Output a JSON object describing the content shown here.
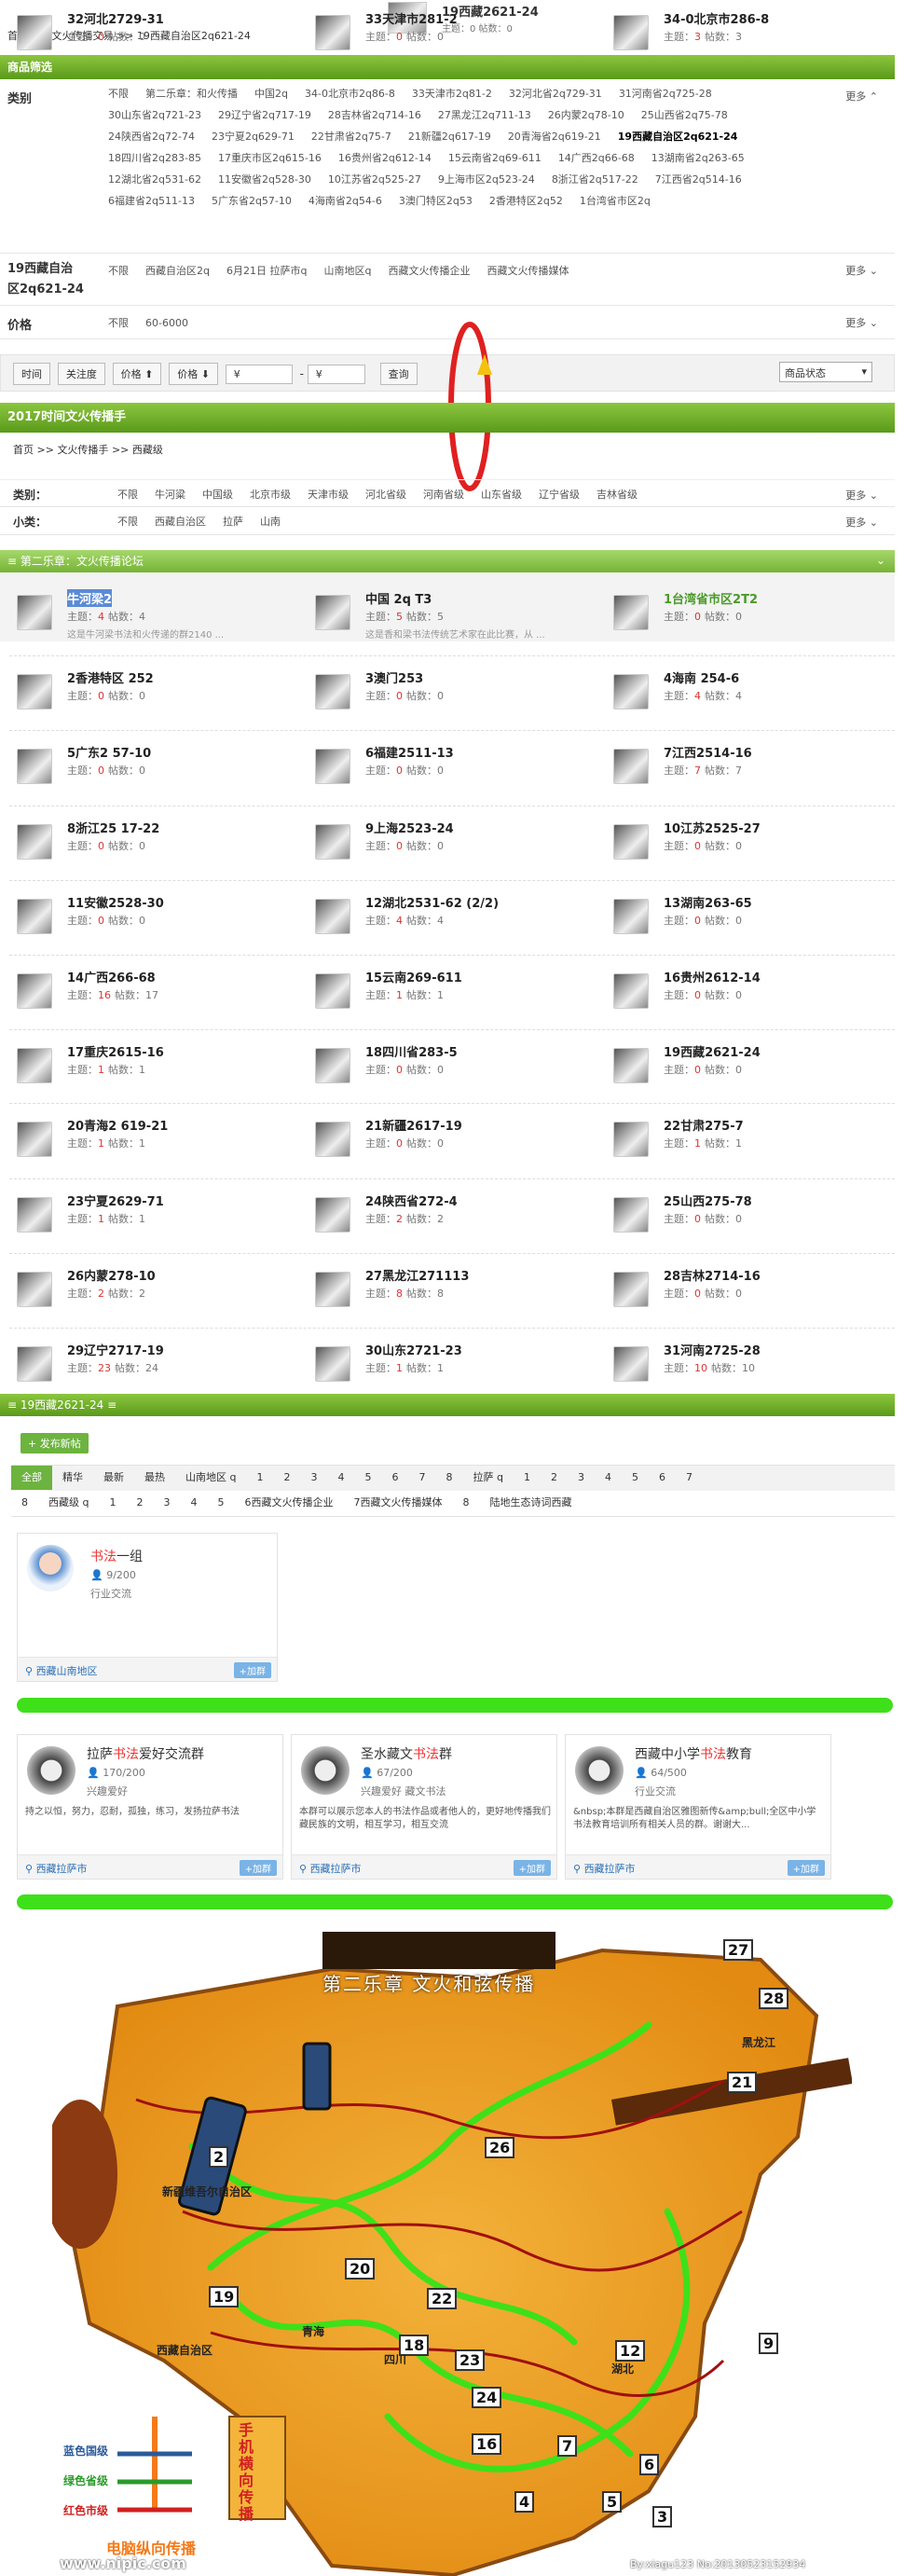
{
  "header": {
    "breadcrumb": [
      "首页",
      "文火传播交易",
      "19西藏自治区2q621-24"
    ],
    "sep": ">>",
    "thumb_title": "19西藏2621-24",
    "thumb_stats": "主题：0  帖数：0"
  },
  "filter": {
    "section_title": "商品筛选",
    "category_label": "类别",
    "category_options": [
      "不限",
      "第二乐章：和火传播",
      "中国2q",
      "34-0北京市2q86-8",
      "33天津市2q81-2",
      "32河北省2q729-31",
      "31河南省2q725-28",
      "30山东省2q721-23",
      "29辽宁省2q717-19",
      "28吉林省2q714-16",
      "27黑龙江2q711-13",
      "26内蒙2q78-10",
      "25山西省2q75-78",
      "24陕西省2q72-74",
      "23宁夏2q629-71",
      "22甘肃省2q75-7",
      "21新疆2q617-19",
      "20青海省2q619-21",
      "19西藏自治区2q621-24",
      "18四川省2q283-85",
      "17重庆市区2q615-16",
      "16贵州省2q612-14",
      "15云南省2q69-611",
      "14广西2q66-68",
      "13湖南省2q263-65",
      "12湖北省2q531-62",
      "11安徽省2q528-30",
      "10江苏省2q525-27",
      "9上海市区2q523-24",
      "8浙江省2q517-22",
      "7江西省2q514-16",
      "6福建省2q511-13",
      "5广东省2q57-10",
      "4海南省2q54-6",
      "3澳门特区2q53",
      "2香港特区2q52",
      "1台湾省市区2q"
    ],
    "category_selected": "19西藏自治区2q621-24",
    "region_label_1": "19西藏自治",
    "region_label_2": "区2q621-24",
    "region_options": [
      "不限",
      "西藏自治区2q",
      "6月21日 拉萨市q",
      "山南地区q",
      "西藏文火传播企业",
      "西藏文火传播媒体"
    ],
    "price_label": "价格",
    "price_options": [
      "不限",
      "60-6000"
    ],
    "more": "更多"
  },
  "toolbar": {
    "sort_time": "时间",
    "sort_attention": "关注度",
    "sort_price1": "价格 ⬆",
    "sort_price2": "价格 ⬇",
    "price_from": "¥",
    "dash": "-",
    "price_to": "¥",
    "query": "查询",
    "status": "商品状态"
  },
  "section2": {
    "title": "2017时间文火传播手",
    "breadcrumb": [
      "首页",
      "文火传播手",
      "西藏级"
    ],
    "sep": ">>",
    "cat_label": "类别：",
    "cat_options": [
      "不限",
      "牛河粱",
      "中国级",
      "北京市级",
      "天津市级",
      "河北省级",
      "河南省级",
      "山东省级",
      "辽宁省级",
      "吉林省级"
    ],
    "sub_label": "小类：",
    "sub_options": [
      "不限",
      "西藏自治区",
      "拉萨",
      "山南"
    ],
    "more": "更多"
  },
  "forum": {
    "title": "第二乐章：文火传播论坛",
    "items": [
      {
        "name": "牛河梁2",
        "stats_pre": "主题：",
        "topics": "4",
        "stats_mid": "帖数：4",
        "desc": "这是牛河梁书法和火传递的群2140 ..."
      },
      {
        "name": "中国 2q T3",
        "stats_pre": "主题：",
        "topics": "5",
        "stats_mid": "帖数：5",
        "desc": "这是香和梁书法传统艺术家在此比赛，从 ..."
      },
      {
        "name": "1台湾省市区2T2",
        "stats_pre": "主题：",
        "topics": "0",
        "stats_mid": "帖数：0",
        "desc": ""
      },
      {
        "name": "2香港特区 252",
        "stats_pre": "主题：",
        "topics": "0",
        "stats_mid": "帖数：0",
        "desc": ""
      },
      {
        "name": "3澳门253",
        "stats_pre": "主题：",
        "topics": "0",
        "stats_mid": "帖数：0",
        "desc": ""
      },
      {
        "name": "4海南 254-6",
        "stats_pre": "主题：",
        "topics": "4",
        "stats_mid": "帖数：4",
        "desc": ""
      },
      {
        "name": "5广东2 57-10",
        "stats_pre": "主题：",
        "topics": "0",
        "stats_mid": "帖数：0",
        "desc": ""
      },
      {
        "name": "6福建2511-13",
        "stats_pre": "主题：",
        "topics": "0",
        "stats_mid": "帖数：0",
        "desc": ""
      },
      {
        "name": "7江西2514-16",
        "stats_pre": "主题：",
        "topics": "7",
        "stats_mid": "帖数：7",
        "desc": ""
      },
      {
        "name": "8浙江25 17-22",
        "stats_pre": "主题：",
        "topics": "0",
        "stats_mid": "帖数：0",
        "desc": ""
      },
      {
        "name": "9上海2523-24",
        "stats_pre": "主题：",
        "topics": "0",
        "stats_mid": "帖数：0",
        "desc": ""
      },
      {
        "name": "10江苏2525-27",
        "stats_pre": "主题：",
        "topics": "0",
        "stats_mid": "帖数：0",
        "desc": ""
      },
      {
        "name": "11安徽2528-30",
        "stats_pre": "主题：",
        "topics": "0",
        "stats_mid": "帖数：0",
        "desc": ""
      },
      {
        "name": "12湖北2531-62 (2/2)",
        "stats_pre": "主题：",
        "topics": "4",
        "stats_mid": "帖数：4",
        "desc": ""
      },
      {
        "name": "13湖南263-65",
        "stats_pre": "主题：",
        "topics": "0",
        "stats_mid": "帖数：0",
        "desc": ""
      },
      {
        "name": "14广西266-68",
        "stats_pre": "主题：",
        "topics": "16",
        "stats_mid": "帖数：17",
        "desc": ""
      },
      {
        "name": "15云南269-611",
        "stats_pre": "主题：",
        "topics": "1",
        "stats_mid": "帖数：1",
        "desc": ""
      },
      {
        "name": "16贵州2612-14",
        "stats_pre": "主题：",
        "topics": "0",
        "stats_mid": "帖数：0",
        "desc": ""
      },
      {
        "name": "17重庆2615-16",
        "stats_pre": "主题：",
        "topics": "1",
        "stats_mid": "帖数：1",
        "desc": ""
      },
      {
        "name": "18四川省283-5",
        "stats_pre": "主题：",
        "topics": "0",
        "stats_mid": "帖数：0",
        "desc": ""
      },
      {
        "name": "19西藏2621-24",
        "stats_pre": "主题：",
        "topics": "0",
        "stats_mid": "帖数：0",
        "desc": ""
      },
      {
        "name": "20青海2 619-21",
        "stats_pre": "主题：",
        "topics": "1",
        "stats_mid": "帖数：1",
        "desc": ""
      },
      {
        "name": "21新疆2617-19",
        "stats_pre": "主题：",
        "topics": "0",
        "stats_mid": "帖数：0",
        "desc": ""
      },
      {
        "name": "22甘肃275-7",
        "stats_pre": "主题：",
        "topics": "1",
        "stats_mid": "帖数：1",
        "desc": ""
      },
      {
        "name": "23宁夏2629-71",
        "stats_pre": "主题：",
        "topics": "1",
        "stats_mid": "帖数：1",
        "desc": ""
      },
      {
        "name": "24陕西省272-4",
        "stats_pre": "主题：",
        "topics": "2",
        "stats_mid": "帖数：2",
        "desc": ""
      },
      {
        "name": "25山西275-78",
        "stats_pre": "主题：",
        "topics": "0",
        "stats_mid": "帖数：0",
        "desc": ""
      },
      {
        "name": "26内蒙278-10",
        "stats_pre": "主题：",
        "topics": "2",
        "stats_mid": "帖数：2",
        "desc": ""
      },
      {
        "name": "27黑龙江271113",
        "stats_pre": "主题：",
        "topics": "8",
        "stats_mid": "帖数：8",
        "desc": ""
      },
      {
        "name": "28吉林2714-16",
        "stats_pre": "主题：",
        "topics": "0",
        "stats_mid": "帖数：0",
        "desc": ""
      },
      {
        "name": "29辽宁2717-19",
        "stats_pre": "主题：",
        "topics": "23",
        "stats_mid": "帖数：24",
        "desc": ""
      },
      {
        "name": "30山东2721-23",
        "stats_pre": "主题：",
        "topics": "1",
        "stats_mid": "帖数：1",
        "desc": ""
      },
      {
        "name": "31河南2725-28",
        "stats_pre": "主题：",
        "topics": "10",
        "stats_mid": "帖数：10",
        "desc": ""
      },
      {
        "name": "32河北2729-31",
        "stats_pre": "主题：",
        "topics": "0",
        "stats_mid": "帖数：0",
        "desc": ""
      },
      {
        "name": "33天津市281-2",
        "stats_pre": "主题：",
        "topics": "0",
        "stats_mid": "帖数：0",
        "desc": ""
      },
      {
        "name": "34-0北京市286-8",
        "stats_pre": "主题：",
        "topics": "3",
        "stats_mid": "帖数：3",
        "desc": ""
      }
    ]
  },
  "board": {
    "title": "19西藏2621-24",
    "post_button": "+ 发布新帖",
    "tabs_row1": [
      "全部",
      "精华",
      "最新",
      "最热",
      "山南地区 q",
      "1",
      "2",
      "3",
      "4",
      "5",
      "6",
      "7",
      "8",
      "拉萨 q",
      "1",
      "2",
      "3",
      "4",
      "5",
      "6",
      "7"
    ],
    "tabs_row2": [
      "8",
      "西藏级 q",
      "1",
      "2",
      "3",
      "4",
      "5",
      "6西藏文火传播企业",
      "7西藏文火传播媒体",
      "8",
      "陆地生态诗词西藏"
    ]
  },
  "group1": {
    "title_a": "书法",
    "title_b": "一组",
    "members": "9/200",
    "tag": "行业交流",
    "loc": "西藏山南地区",
    "join": "+加群"
  },
  "groups": [
    {
      "title_a": "拉萨",
      "title_hl": "书法",
      "title_b": "爱好交流群",
      "members": "170/200",
      "tag": "兴趣爱好",
      "desc": "持之以恒，努力，忍耐，孤独，练习，发扬拉萨书法",
      "loc": "西藏拉萨市",
      "join": "+加群"
    },
    {
      "title_a": "圣水藏文",
      "title_hl": "书法",
      "title_b": "群",
      "members": "67/200",
      "tag": "兴趣爱好  藏文书法",
      "desc": "本群可以展示您本人的书法作品或者他人的，更好地传播我们藏民族的文明，相互学习，相互交流",
      "loc": "西藏拉萨市",
      "join": "+加群"
    },
    {
      "title_a": "西藏中小学",
      "title_hl": "书法",
      "title_b": "教育",
      "members": "64/500",
      "tag": "行业交流",
      "desc": "&nbsp;本群是西藏自治区雅图新传&amp;bull;全区中小学书法教育培训所有相关人员的群。谢谢大...",
      "loc": "西藏拉萨市",
      "join": "+加群"
    }
  ],
  "poster": {
    "heading": "第二乐章  文火和弦传播",
    "legend_blue": "蓝色国级",
    "legend_green": "绿色省级",
    "legend_red": "红色市级",
    "vertical_text": "手机横向传播",
    "bottom_text": "电脑纵向传播",
    "watermark": "www.nipic.com",
    "credit": "By:xiagu123  No:20130523152934",
    "region_labels": [
      "西藏自治区",
      "新疆维吾尔自治区",
      "青海",
      "四川",
      "湖北",
      "黑龙江"
    ],
    "numbers": [
      "27",
      "28",
      "21",
      "26",
      "20",
      "19",
      "22",
      "23",
      "24",
      "18",
      "16",
      "12",
      "9",
      "7",
      "2",
      "3",
      "4",
      "5",
      "6"
    ]
  },
  "colors": {
    "green": "#6db33f",
    "red": "#d33",
    "highlight": "#2a6fb6"
  }
}
